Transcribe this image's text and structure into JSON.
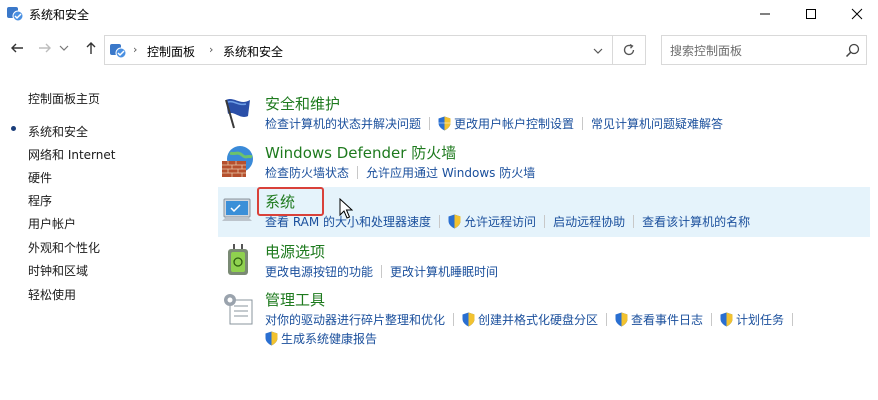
{
  "window": {
    "title": "系统和安全",
    "controls": {
      "minimize": "—",
      "maximize": "☐",
      "close": "✕"
    }
  },
  "nav": {
    "breadcrumb": [
      "控制面板",
      "系统和安全"
    ],
    "search_placeholder": "搜索控制面板"
  },
  "sidebar": {
    "home": "控制面板主页",
    "items": [
      "系统和安全",
      "网络和 Internet",
      "硬件",
      "程序",
      "用户帐户",
      "外观和个性化",
      "时钟和区域",
      "轻松使用"
    ]
  },
  "categories": [
    {
      "title": "安全和维护",
      "icon": "flag-icon",
      "links": [
        {
          "label": "检查计算机的状态并解决问题",
          "shield": false
        },
        {
          "label": "更改用户帐户控制设置",
          "shield": true
        },
        {
          "label": "常见计算机问题疑难解答",
          "shield": false
        }
      ]
    },
    {
      "title": "Windows Defender 防火墙",
      "icon": "firewall-icon",
      "links": [
        {
          "label": "检查防火墙状态",
          "shield": false
        },
        {
          "label": "允许应用通过 Windows 防火墙",
          "shield": false
        }
      ]
    },
    {
      "title": "系统",
      "icon": "system-icon",
      "links": [
        {
          "label": "查看 RAM 的大小和处理器速度",
          "shield": false
        },
        {
          "label": "允许远程访问",
          "shield": true
        },
        {
          "label": "启动远程协助",
          "shield": false
        },
        {
          "label": "查看该计算机的名称",
          "shield": false
        }
      ]
    },
    {
      "title": "电源选项",
      "icon": "power-options-icon",
      "links": [
        {
          "label": "更改电源按钮的功能",
          "shield": false
        },
        {
          "label": "更改计算机睡眠时间",
          "shield": false
        }
      ]
    },
    {
      "title": "管理工具",
      "icon": "admin-tools-icon",
      "links": [
        {
          "label": "对你的驱动器进行碎片整理和优化",
          "shield": false
        },
        {
          "label": "创建并格式化硬盘分区",
          "shield": true
        },
        {
          "label": "查看事件日志",
          "shield": true
        },
        {
          "label": "计划任务",
          "shield": true
        }
      ],
      "links2": [
        {
          "label": "生成系统健康报告",
          "shield": true
        }
      ]
    }
  ],
  "colors": {
    "category_title": "#1e7a1e",
    "link": "#1a4f9c",
    "highlight_bg": "#e5f3fb",
    "annotation_box": "#d9413a"
  }
}
